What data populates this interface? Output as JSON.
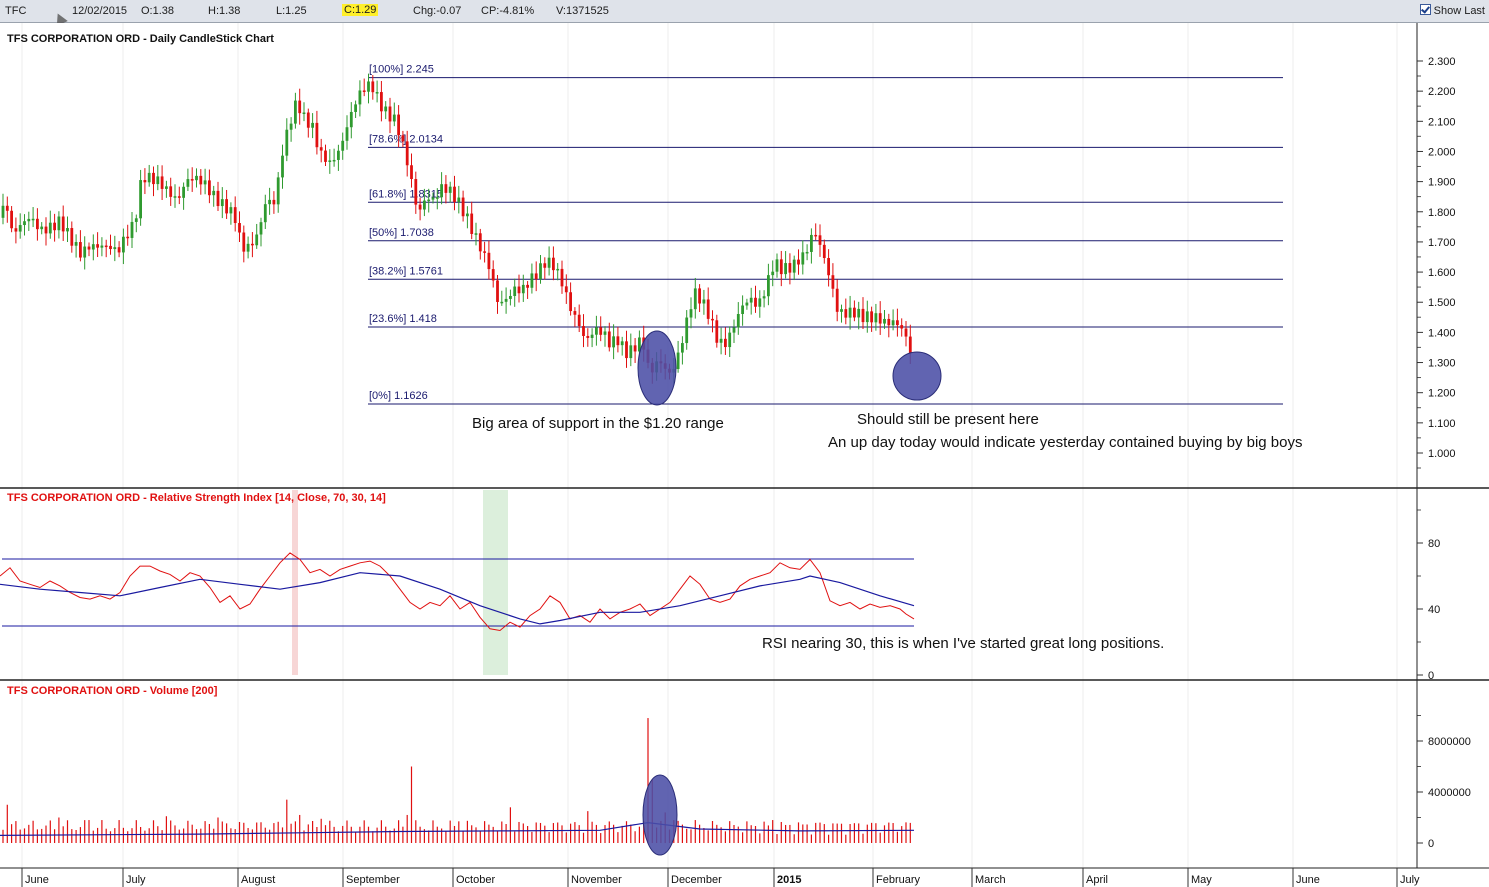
{
  "topbar": {
    "symbol": "TFC",
    "date": "12/02/2015",
    "open": "O:1.38",
    "high": "H:1.38",
    "low": "L:1.25",
    "close": "C:1.29",
    "change": "Chg:-0.07",
    "change_pct": "CP:-4.81%",
    "volume": "V:1371525",
    "show_last_label": "Show Last"
  },
  "colors": {
    "up": "#2f9a2f",
    "down": "#e01010",
    "fib_line": "#1a1a6e",
    "rsi_line": "#e01010",
    "rsi_ma": "#1a1aa0",
    "highlight_ellipse": "#4b4fa6",
    "panel_title": "#e01010"
  },
  "annotations": {
    "support": "Big area of support in the $1.20 range",
    "present": "Should still be present here",
    "upday": "An up day today would indicate yesterday contained buying by big boys",
    "rsi_note": "RSI nearing 30, this is when I've started great long positions."
  },
  "chart_data": [
    {
      "type": "candlestick",
      "title": "TFS CORPORATION ORD - Daily CandleStick Chart",
      "ylim": [
        0.95,
        2.32
      ],
      "y_ticks": [
        "2.300",
        "2.200",
        "2.100",
        "2.000",
        "1.900",
        "1.800",
        "1.700",
        "1.600",
        "1.500",
        "1.400",
        "1.300",
        "1.200",
        "1.100",
        "1.000"
      ],
      "x_labels": [
        "June",
        "July",
        "August",
        "September",
        "October",
        "November",
        "December",
        "2015",
        "February",
        "March",
        "April",
        "May",
        "June",
        "July"
      ],
      "fibonacci_levels": [
        {
          "label": "[100%] 2.245",
          "value": 2.245
        },
        {
          "label": "[78.6%] 2.0134",
          "value": 2.0134
        },
        {
          "label": "[61.8%] 1.8315",
          "value": 1.8315
        },
        {
          "label": "[50%] 1.7038",
          "value": 1.7038
        },
        {
          "label": "[38.2%] 1.5761",
          "value": 1.5761
        },
        {
          "label": "[23.6%] 1.418",
          "value": 1.418
        },
        {
          "label": "[0%] 1.1626",
          "value": 1.1626
        }
      ],
      "close_path": [
        [
          0,
          1.78
        ],
        [
          6,
          1.85
        ],
        [
          12,
          1.74
        ],
        [
          20,
          1.75
        ],
        [
          30,
          1.77
        ],
        [
          40,
          1.74
        ],
        [
          50,
          1.76
        ],
        [
          60,
          1.77
        ],
        [
          70,
          1.7
        ],
        [
          80,
          1.66
        ],
        [
          90,
          1.7
        ],
        [
          100,
          1.69
        ],
        [
          110,
          1.67
        ],
        [
          118,
          1.66
        ],
        [
          125,
          1.72
        ],
        [
          135,
          1.78
        ],
        [
          142,
          1.92
        ],
        [
          150,
          1.9
        ],
        [
          160,
          1.89
        ],
        [
          170,
          1.87
        ],
        [
          178,
          1.85
        ],
        [
          186,
          1.9
        ],
        [
          195,
          1.9
        ],
        [
          205,
          1.89
        ],
        [
          215,
          1.86
        ],
        [
          225,
          1.82
        ],
        [
          235,
          1.77
        ],
        [
          242,
          1.67
        ],
        [
          250,
          1.69
        ],
        [
          258,
          1.74
        ],
        [
          266,
          1.84
        ],
        [
          275,
          1.82
        ],
        [
          283,
          2.0
        ],
        [
          290,
          2.1
        ],
        [
          297,
          2.18
        ],
        [
          304,
          2.12
        ],
        [
          312,
          2.08
        ],
        [
          320,
          1.98
        ],
        [
          330,
          1.96
        ],
        [
          340,
          2.02
        ],
        [
          348,
          2.1
        ],
        [
          356,
          2.16
        ],
        [
          364,
          2.2
        ],
        [
          372,
          2.22
        ],
        [
          380,
          2.17
        ],
        [
          388,
          2.13
        ],
        [
          395,
          2.1
        ],
        [
          402,
          2.02
        ],
        [
          410,
          1.92
        ],
        [
          418,
          1.8
        ],
        [
          426,
          1.86
        ],
        [
          434,
          1.84
        ],
        [
          442,
          1.87
        ],
        [
          450,
          1.86
        ],
        [
          458,
          1.84
        ],
        [
          466,
          1.8
        ],
        [
          474,
          1.73
        ],
        [
          482,
          1.66
        ],
        [
          490,
          1.6
        ],
        [
          498,
          1.5
        ],
        [
          506,
          1.52
        ],
        [
          514,
          1.55
        ],
        [
          522,
          1.53
        ],
        [
          530,
          1.56
        ],
        [
          538,
          1.6
        ],
        [
          546,
          1.65
        ],
        [
          554,
          1.63
        ],
        [
          562,
          1.56
        ],
        [
          570,
          1.47
        ],
        [
          578,
          1.43
        ],
        [
          586,
          1.38
        ],
        [
          594,
          1.42
        ],
        [
          602,
          1.4
        ],
        [
          610,
          1.35
        ],
        [
          618,
          1.37
        ],
        [
          626,
          1.34
        ],
        [
          634,
          1.36
        ],
        [
          642,
          1.38
        ],
        [
          648,
          1.28
        ],
        [
          652,
          1.26
        ],
        [
          658,
          1.3
        ],
        [
          664,
          1.29
        ],
        [
          670,
          1.27
        ],
        [
          678,
          1.33
        ],
        [
          686,
          1.42
        ],
        [
          694,
          1.52
        ],
        [
          702,
          1.5
        ],
        [
          710,
          1.46
        ],
        [
          718,
          1.38
        ],
        [
          726,
          1.36
        ],
        [
          734,
          1.41
        ],
        [
          742,
          1.48
        ],
        [
          750,
          1.52
        ],
        [
          758,
          1.5
        ],
        [
          766,
          1.55
        ],
        [
          774,
          1.62
        ],
        [
          782,
          1.6
        ],
        [
          790,
          1.62
        ],
        [
          798,
          1.65
        ],
        [
          806,
          1.67
        ],
        [
          814,
          1.73
        ],
        [
          822,
          1.66
        ],
        [
          830,
          1.58
        ],
        [
          838,
          1.48
        ],
        [
          846,
          1.47
        ],
        [
          854,
          1.46
        ],
        [
          862,
          1.44
        ],
        [
          870,
          1.45
        ],
        [
          878,
          1.46
        ],
        [
          886,
          1.44
        ],
        [
          894,
          1.43
        ],
        [
          902,
          1.4
        ],
        [
          908,
          1.36
        ],
        [
          914,
          1.29
        ]
      ]
    },
    {
      "type": "line",
      "title": "TFS CORPORATION ORD - Relative Strength Index [14, Close, 70, 30, 14]",
      "ylim": [
        0,
        100
      ],
      "y_ticks": [
        "80",
        "40",
        "0"
      ],
      "bands": [
        70,
        30
      ],
      "series": [
        {
          "values": [
            [
              0,
              60
            ],
            [
              10,
              65
            ],
            [
              20,
              57
            ],
            [
              30,
              55
            ],
            [
              40,
              53
            ],
            [
              50,
              57
            ],
            [
              60,
              54
            ],
            [
              70,
              50
            ],
            [
              80,
              47
            ],
            [
              90,
              46
            ],
            [
              100,
              48
            ],
            [
              110,
              46
            ],
            [
              120,
              50
            ],
            [
              130,
              60
            ],
            [
              140,
              66
            ],
            [
              150,
              66
            ],
            [
              160,
              63
            ],
            [
              170,
              61
            ],
            [
              180,
              57
            ],
            [
              190,
              62
            ],
            [
              200,
              60
            ],
            [
              210,
              53
            ],
            [
              220,
              44
            ],
            [
              230,
              48
            ],
            [
              240,
              40
            ],
            [
              250,
              43
            ],
            [
              260,
              52
            ],
            [
              270,
              60
            ],
            [
              280,
              68
            ],
            [
              290,
              74
            ],
            [
              300,
              70
            ],
            [
              310,
              62
            ],
            [
              320,
              64
            ],
            [
              330,
              60
            ],
            [
              340,
              64
            ],
            [
              350,
              66
            ],
            [
              360,
              68
            ],
            [
              370,
              69
            ],
            [
              380,
              66
            ],
            [
              390,
              60
            ],
            [
              400,
              52
            ],
            [
              410,
              44
            ],
            [
              420,
              40
            ],
            [
              430,
              44
            ],
            [
              440,
              42
            ],
            [
              450,
              48
            ],
            [
              460,
              40
            ],
            [
              470,
              44
            ],
            [
              480,
              35
            ],
            [
              490,
              28
            ],
            [
              500,
              27
            ],
            [
              510,
              32
            ],
            [
              520,
              29
            ],
            [
              530,
              36
            ],
            [
              540,
              40
            ],
            [
              550,
              48
            ],
            [
              560,
              44
            ],
            [
              570,
              34
            ],
            [
              580,
              36
            ],
            [
              590,
              32
            ],
            [
              600,
              40
            ],
            [
              610,
              34
            ],
            [
              620,
              38
            ],
            [
              630,
              40
            ],
            [
              640,
              43
            ],
            [
              650,
              36
            ],
            [
              660,
              40
            ],
            [
              670,
              44
            ],
            [
              680,
              52
            ],
            [
              690,
              60
            ],
            [
              700,
              55
            ],
            [
              710,
              46
            ],
            [
              720,
              44
            ],
            [
              730,
              46
            ],
            [
              740,
              54
            ],
            [
              750,
              58
            ],
            [
              760,
              60
            ],
            [
              770,
              62
            ],
            [
              780,
              68
            ],
            [
              790,
              65
            ],
            [
              800,
              64
            ],
            [
              810,
              70
            ],
            [
              820,
              62
            ],
            [
              830,
              45
            ],
            [
              840,
              42
            ],
            [
              850,
              44
            ],
            [
              860,
              40
            ],
            [
              870,
              43
            ],
            [
              880,
              41
            ],
            [
              890,
              42
            ],
            [
              900,
              40
            ],
            [
              906,
              37
            ],
            [
              914,
              34
            ]
          ]
        },
        {
          "values": [
            [
              0,
              55
            ],
            [
              40,
              52
            ],
            [
              80,
              50
            ],
            [
              120,
              48
            ],
            [
              160,
              53
            ],
            [
              200,
              58
            ],
            [
              240,
              55
            ],
            [
              280,
              52
            ],
            [
              320,
              56
            ],
            [
              360,
              62
            ],
            [
              400,
              60
            ],
            [
              440,
              52
            ],
            [
              480,
              42
            ],
            [
              520,
              34
            ],
            [
              540,
              31
            ],
            [
              560,
              33
            ],
            [
              600,
              38
            ],
            [
              640,
              38
            ],
            [
              680,
              42
            ],
            [
              720,
              48
            ],
            [
              760,
              54
            ],
            [
              800,
              58
            ],
            [
              810,
              60
            ],
            [
              840,
              56
            ],
            [
              880,
              48
            ],
            [
              914,
              42
            ]
          ]
        }
      ]
    },
    {
      "type": "bar",
      "title": "TFS CORPORATION ORD - Volume [200]",
      "ylim": [
        0,
        10000000
      ],
      "y_ticks": [
        "8000000",
        "4000000",
        "0"
      ],
      "spikes": [
        [
          6,
          3000000
        ],
        [
          60,
          2000000
        ],
        [
          90,
          1800000
        ],
        [
          165,
          2100000
        ],
        [
          220,
          2000000
        ],
        [
          286,
          3400000
        ],
        [
          300,
          2200000
        ],
        [
          320,
          1900000
        ],
        [
          408,
          2200000
        ],
        [
          413,
          6000000
        ],
        [
          460,
          1700000
        ],
        [
          512,
          2800000
        ],
        [
          588,
          2500000
        ],
        [
          648,
          9800000
        ],
        [
          652,
          5000000
        ],
        [
          664,
          2400000
        ],
        [
          672,
          1800000
        ],
        [
          694,
          1800000
        ],
        [
          774,
          1800000
        ],
        [
          820,
          1600000
        ]
      ],
      "ma_path": [
        [
          0,
          600000
        ],
        [
          200,
          700000
        ],
        [
          300,
          800000
        ],
        [
          400,
          900000
        ],
        [
          500,
          950000
        ],
        [
          600,
          1000000
        ],
        [
          648,
          1600000
        ],
        [
          700,
          1100000
        ],
        [
          800,
          950000
        ],
        [
          914,
          1000000
        ]
      ]
    }
  ]
}
